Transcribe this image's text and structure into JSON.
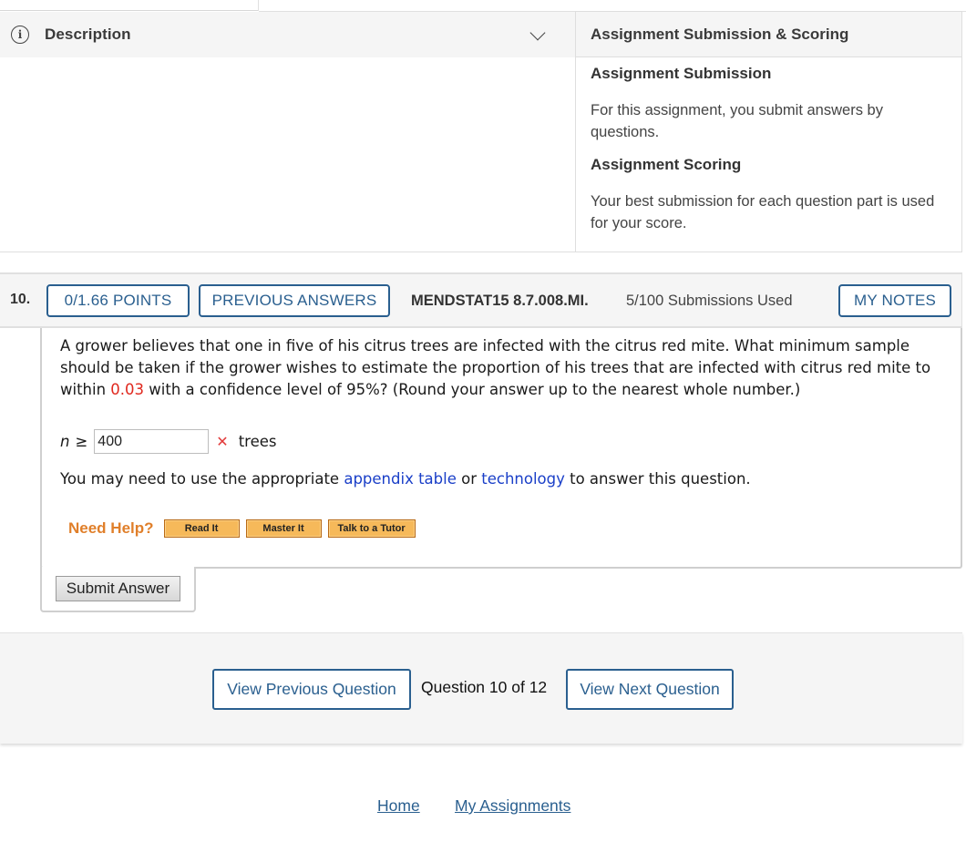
{
  "description_panel": {
    "title": "Description",
    "icon": "info-icon",
    "toggle_icon": "chevron-down-icon"
  },
  "scoring_panel": {
    "title": "Assignment Submission & Scoring",
    "submission_heading": "Assignment Submission",
    "submission_text": "For this assignment, you submit answers by questions.",
    "scoring_heading": "Assignment Scoring",
    "scoring_text": "Your best submission for each question part is used for your score."
  },
  "question": {
    "number": "10.",
    "points_label": "0/1.66 POINTS",
    "previous_answers_label": "PREVIOUS ANSWERS",
    "code": "MENDSTAT15 8.7.008.MI.",
    "submissions": "5/100 Submissions Used",
    "my_notes_label": "MY NOTES",
    "text_part1": "A grower believes that one in five of his citrus trees are infected with the citrus red mite. What minimum sample should be taken if the grower wishes to estimate the proportion of his trees that are infected with citrus red mite to within ",
    "highlight_value": "0.03",
    "text_part2": " with a confidence level of 95%? (Round your answer up to the nearest whole number.)",
    "answer": {
      "variable": "n",
      "relation": "≥",
      "value": "400",
      "status_icon": "✕",
      "status": "incorrect",
      "unit": "trees"
    },
    "hint": {
      "before": "You may need to use the appropriate ",
      "link1": "appendix table",
      "middle": " or ",
      "link2": "technology",
      "after": " to answer this question."
    },
    "help": {
      "label": "Need Help?",
      "buttons": [
        "Read It",
        "Master It",
        "Talk to a Tutor"
      ]
    },
    "submit_label": "Submit Answer"
  },
  "navigation": {
    "previous_label": "View Previous Question",
    "counter": "Question 10 of 12",
    "next_label": "View Next Question"
  },
  "footer": {
    "home": "Home",
    "my_assignments": "My Assignments"
  },
  "colors": {
    "accent": "#2a5f8f",
    "error": "#e0281e",
    "link": "#1a3fc8",
    "help": "#e07f2a",
    "help_button": "#f6b95a"
  }
}
